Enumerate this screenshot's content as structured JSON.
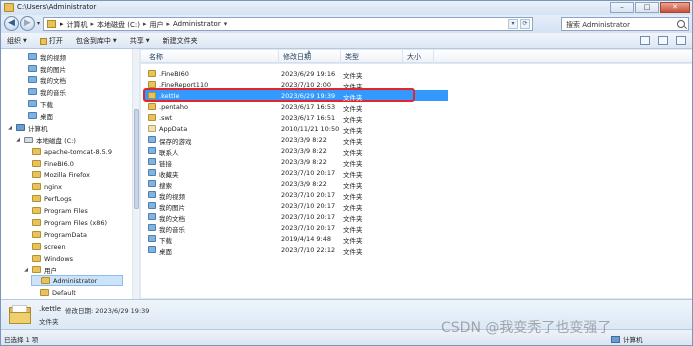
{
  "window": {
    "title": "C:\\Users\\Administrator",
    "controls": {
      "minimize": "–",
      "maximize": "□",
      "close": "✕"
    }
  },
  "address": {
    "crumbs": [
      "计算机",
      "本地磁盘 (C:)",
      "用户",
      "Administrator"
    ],
    "separator": "▸",
    "refresh_symbol": "⟳"
  },
  "search": {
    "placeholder": "搜索 Administrator"
  },
  "toolbar": {
    "organize": "组织",
    "open": "打开",
    "include_in_library": "包含到库中",
    "share": "共享",
    "new_folder": "新建文件夹"
  },
  "nav": {
    "items": [
      {
        "label": "我的视频",
        "icon": "folder-special-icon"
      },
      {
        "label": "我的图片",
        "icon": "folder-special-icon"
      },
      {
        "label": "我的文档",
        "icon": "folder-special-icon"
      },
      {
        "label": "我的音乐",
        "icon": "folder-special-icon"
      },
      {
        "label": "下载",
        "icon": "folder-special-icon"
      },
      {
        "label": "桌面",
        "icon": "folder-special-icon"
      },
      {
        "label": "计算机",
        "icon": "computer-icon"
      },
      {
        "label": "本地磁盘 (C:)",
        "icon": "drive-icon"
      },
      {
        "label": "apache-tomcat-8.5.9",
        "icon": "folder-icon"
      },
      {
        "label": "FineBI6.0",
        "icon": "folder-icon"
      },
      {
        "label": "Mozilla Firefox",
        "icon": "folder-icon"
      },
      {
        "label": "nginx",
        "icon": "folder-icon"
      },
      {
        "label": "PerfLogs",
        "icon": "folder-icon"
      },
      {
        "label": "Program Files",
        "icon": "folder-icon"
      },
      {
        "label": "Program Files (x86)",
        "icon": "folder-icon"
      },
      {
        "label": "ProgramData",
        "icon": "folder-icon"
      },
      {
        "label": "screen",
        "icon": "folder-icon"
      },
      {
        "label": "Windows",
        "icon": "folder-icon"
      },
      {
        "label": "用户",
        "icon": "folder-icon"
      },
      {
        "label": "Administrator",
        "icon": "folder-icon"
      },
      {
        "label": "Default",
        "icon": "folder-icon"
      }
    ]
  },
  "columns": {
    "name": "名称",
    "date": "修改日期",
    "type": "类型",
    "size": "大小"
  },
  "files": [
    {
      "name": ".FineBI60",
      "date": "2023/6/29 19:16",
      "type": "文件夹"
    },
    {
      "name": ".FineReport110",
      "date": "2023/7/10 2:00",
      "type": "文件夹"
    },
    {
      "name": ".kettle",
      "date": "2023/6/29 19:39",
      "type": "文件夹"
    },
    {
      "name": ".pentaho",
      "date": "2023/6/17 16:53",
      "type": "文件夹"
    },
    {
      "name": ".swt",
      "date": "2023/6/17 16:51",
      "type": "文件夹"
    },
    {
      "name": "AppData",
      "date": "2010/11/21 10:50",
      "type": "文件夹"
    },
    {
      "name": "保存的游戏",
      "date": "2023/3/9 8:22",
      "type": "文件夹"
    },
    {
      "name": "联系人",
      "date": "2023/3/9 8:22",
      "type": "文件夹"
    },
    {
      "name": "链接",
      "date": "2023/3/9 8:22",
      "type": "文件夹"
    },
    {
      "name": "收藏夹",
      "date": "2023/7/10 20:17",
      "type": "文件夹"
    },
    {
      "name": "搜索",
      "date": "2023/3/9 8:22",
      "type": "文件夹"
    },
    {
      "name": "我的视频",
      "date": "2023/7/10 20:17",
      "type": "文件夹"
    },
    {
      "name": "我的图片",
      "date": "2023/7/10 20:17",
      "type": "文件夹"
    },
    {
      "name": "我的文档",
      "date": "2023/7/10 20:17",
      "type": "文件夹"
    },
    {
      "name": "我的音乐",
      "date": "2023/7/10 20:17",
      "type": "文件夹"
    },
    {
      "name": "下载",
      "date": "2019/4/14 9:48",
      "type": "文件夹"
    },
    {
      "name": "桌面",
      "date": "2023/7/10 22:12",
      "type": "文件夹"
    }
  ],
  "details": {
    "name": ".kettle",
    "modified_label": "修改日期:",
    "modified": "2023/6/29 19:39",
    "type": "文件夹"
  },
  "status": {
    "selected": "已选择 1 项",
    "location": "计算机"
  },
  "watermark": "CSDN @我变秃了也变强了"
}
